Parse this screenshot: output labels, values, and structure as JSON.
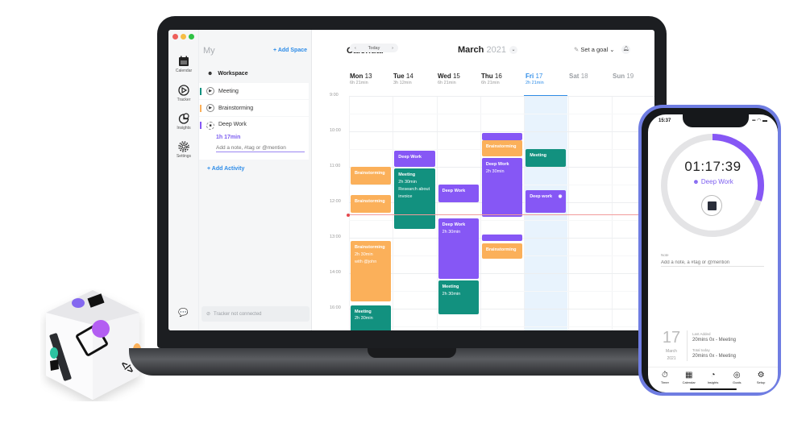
{
  "desktop": {
    "window_controls": {
      "close": "#ee5f5b",
      "minimize": "#f7bd45",
      "maximize": "#2fc245"
    },
    "rail": {
      "items": [
        {
          "label": "Calendar",
          "icon": "calendar-icon"
        },
        {
          "label": "Tracker",
          "icon": "tracker-icon"
        },
        {
          "label": "Insights",
          "icon": "insights-icon"
        },
        {
          "label": "Settings",
          "icon": "settings-icon"
        }
      ]
    },
    "panel": {
      "title_prefix": "My",
      "title": "Calendar",
      "add_space": "+ Add Space",
      "workspace": "Workspace",
      "activities": [
        {
          "label": "Meeting",
          "color": "#12917f",
          "state": "play"
        },
        {
          "label": "Brainstorming",
          "color": "#fbb05a",
          "state": "play"
        },
        {
          "label": "Deep Work",
          "color": "#8657f5",
          "state": "running",
          "duration": "1h 17min",
          "note_placeholder": "Add a note, #tag or @mention"
        }
      ],
      "add_activity": "+ Add Activity",
      "tracker_status": "Tracker not connected"
    },
    "calendar": {
      "nav": {
        "prev": "‹",
        "today": "Today",
        "next": "›"
      },
      "month": "March",
      "year": "2021",
      "goal": "Set a goal",
      "days": [
        {
          "name": "Mon",
          "date": "13",
          "total": "6h 21min"
        },
        {
          "name": "Tue",
          "date": "14",
          "total": "3h 12min"
        },
        {
          "name": "Wed",
          "date": "15",
          "total": "6h 21min"
        },
        {
          "name": "Thu",
          "date": "16",
          "total": "6h 21min"
        },
        {
          "name": "Fri",
          "date": "17",
          "total": "2h 21min"
        },
        {
          "name": "Sat",
          "date": "18",
          "total": ""
        },
        {
          "name": "Sun",
          "date": "19",
          "total": ""
        }
      ],
      "times": [
        "9:00",
        "10:00",
        "11:00",
        "12:00",
        "13:00",
        "14:00",
        "16:00"
      ],
      "events": [
        {
          "day": 0,
          "start": 11.0,
          "end": 11.5,
          "type": "orange",
          "title": "Brainstorming"
        },
        {
          "day": 0,
          "start": 11.8,
          "end": 12.3,
          "type": "orange",
          "title": "Brainstorming"
        },
        {
          "day": 0,
          "start": 13.1,
          "end": 14.8,
          "type": "orange",
          "title": "Brainstorming",
          "lines": [
            "2h 30min",
            "with @john"
          ]
        },
        {
          "day": 0,
          "start": 14.9,
          "end": 15.8,
          "type": "teal",
          "title": "Meeting",
          "lines": [
            "2h 30min"
          ]
        },
        {
          "day": 1,
          "start": 10.55,
          "end": 11.0,
          "type": "purple",
          "title": "Deep Work"
        },
        {
          "day": 1,
          "start": 11.05,
          "end": 12.75,
          "type": "teal",
          "title": "Meeting",
          "lines": [
            "2h 30min",
            "Research about invoice"
          ]
        },
        {
          "day": 2,
          "start": 11.5,
          "end": 12.0,
          "type": "purple",
          "title": "Deep Work"
        },
        {
          "day": 2,
          "start": 12.45,
          "end": 14.15,
          "type": "purple",
          "title": "Deep Work",
          "lines": [
            "2h 30min"
          ]
        },
        {
          "day": 2,
          "start": 14.2,
          "end": 15.15,
          "type": "teal",
          "title": "Meeting",
          "lines": [
            "2h 30min"
          ]
        },
        {
          "day": 3,
          "start": 10.05,
          "end": 10.25,
          "type": "purple",
          "title": ""
        },
        {
          "day": 3,
          "start": 10.25,
          "end": 10.7,
          "type": "orange",
          "title": "Brainstorming"
        },
        {
          "day": 3,
          "start": 10.75,
          "end": 12.4,
          "type": "purple",
          "title": "Deep Work",
          "lines": [
            "2h 30min"
          ]
        },
        {
          "day": 3,
          "start": 12.9,
          "end": 13.1,
          "type": "purple",
          "title": ""
        },
        {
          "day": 3,
          "start": 13.15,
          "end": 13.6,
          "type": "orange",
          "title": "Brainstorming"
        },
        {
          "day": 4,
          "start": 10.5,
          "end": 11.0,
          "type": "teal",
          "title": "Meeting"
        },
        {
          "day": 4,
          "start": 11.65,
          "end": 12.3,
          "type": "purple",
          "title": "Deep work",
          "running": true
        }
      ],
      "now": 12.35
    }
  },
  "phone": {
    "status_time": "15:37",
    "status_icons": "▪▪ ◠ ▬",
    "timer": "01:17:39",
    "activity": "Deep Work",
    "progress": 0.3,
    "note_label": "Note",
    "note_placeholder": "Add a note, a #tag or @mention",
    "day": "17",
    "month": "March",
    "year": "2021",
    "last_added_label": "Last Added",
    "last_added_value": "20mins 0x - Meeting",
    "total_today_label": "Total today",
    "total_today_value": "20mins 0x - Meeting",
    "tabs": [
      {
        "label": "Timer",
        "icon": "timer-icon"
      },
      {
        "label": "Calendar",
        "icon": "calendar-icon"
      },
      {
        "label": "Insights",
        "icon": "insights-icon"
      },
      {
        "label": "Goals",
        "icon": "goals-icon"
      },
      {
        "label": "Setup",
        "icon": "setup-icon"
      }
    ]
  },
  "colors": {
    "purple": "#8657f5",
    "orange": "#fbb05a",
    "teal": "#12917f",
    "blue": "#2d8ce8",
    "phone_frame": "#6f7de2"
  }
}
